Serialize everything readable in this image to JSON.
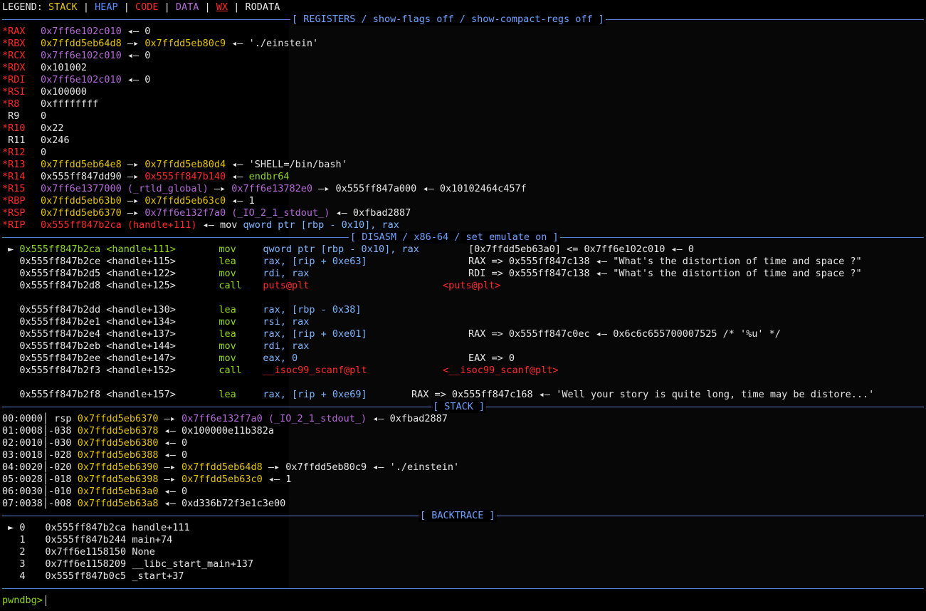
{
  "legend": {
    "label": "LEGEND:",
    "items": [
      {
        "text": "STACK",
        "color": "#e5c400"
      },
      {
        "text": "HEAP",
        "color": "#5a8dff"
      },
      {
        "text": "CODE",
        "color": "#ff2a2a"
      },
      {
        "text": "DATA",
        "color": "#b56bd8"
      },
      {
        "text": "WX",
        "color": "#ff2a2a"
      },
      {
        "text": "RODATA",
        "color": "#e6e6e6"
      }
    ]
  },
  "sections": {
    "registers": "[ REGISTERS / show-flags off / show-compact-regs off ]",
    "disasm": "[ DISASM / x86-64 / set emulate on ]",
    "stack": "[ STACK ]",
    "backtrace": "[ BACKTRACE ]"
  },
  "registers": [
    {
      "name": "*RAX",
      "val": "0x7ff6e102c010",
      "rest": " ◂— 0"
    },
    {
      "name": "*RBX",
      "val": "0x7ffdd5eb64d8",
      "mid": " —▸ ",
      "val2": "0x7ffdd5eb80c9",
      "rest": " ◂— './einstein'"
    },
    {
      "name": "*RCX",
      "val": "0x7ff6e102c010",
      "rest": " ◂— 0"
    },
    {
      "name": "*RDX",
      "val": "0x101002",
      "rest": ""
    },
    {
      "name": "*RDI",
      "val": "0x7ff6e102c010",
      "rest": " ◂— 0"
    },
    {
      "name": "*RSI",
      "val": "0x100000",
      "rest": ""
    },
    {
      "name": "*R8",
      "val": "0xffffffff",
      "rest": ""
    },
    {
      "name": " R9",
      "val": "0",
      "rest": ""
    },
    {
      "name": "*R10",
      "val": "0x22",
      "rest": ""
    },
    {
      "name": " R11",
      "val": "0x246",
      "rest": ""
    },
    {
      "name": "*R12",
      "val": "0",
      "rest": ""
    },
    {
      "name": "*R13",
      "val": "0x7ffdd5eb64e8",
      "mid": " —▸ ",
      "val2": "0x7ffdd5eb80d4",
      "rest": " ◂— 'SHELL=/bin/bash'"
    },
    {
      "name": "*R14",
      "val": "0x555ff847dd90",
      "mid": " —▸ ",
      "val2": "0x555ff847b140",
      "rest": " ◂— ",
      "tail": "endbr64"
    },
    {
      "name": "*R15",
      "val": "0x7ff6e1377000 (_rtld_global)",
      "mid": " —▸ ",
      "val2": "0x7ff6e13782e0",
      "rest": " —▸ 0x555ff847a000 ◂— 0x10102464c457f"
    },
    {
      "name": "*RBP",
      "val": "0x7ffdd5eb63b0",
      "mid": " —▸ ",
      "val2": "0x7ffdd5eb63c0",
      "rest": " ◂— 1"
    },
    {
      "name": "*RSP",
      "val": "0x7ffdd5eb6370",
      "mid": " —▸ ",
      "val2": "0x7ff6e132f7a0 (_IO_2_1_stdout_)",
      "rest": " ◂— 0xfbad2887"
    },
    {
      "name": "*RIP",
      "val": "0x555ff847b2ca (handle+111)",
      "rest": " ◂— mov ",
      "tail": "qword ptr [rbp - 0x10], rax"
    }
  ],
  "disasm": [
    {
      "marker": " ► ",
      "addr": "0x555ff847b2ca <handle+111>",
      "op": "mov",
      "args": "qword ptr [rbp - 0x10], rax",
      "comment": "[0x7ffdd5eb63a0] <= 0x7ff6e102c010 ◂— 0"
    },
    {
      "marker": "   ",
      "addr": "0x555ff847b2ce <handle+115>",
      "op": "lea",
      "args": "rax, [rip + 0xe63]",
      "comment": "RAX => 0x555ff847c138 ◂— \"What's the distortion of time and space ?\""
    },
    {
      "marker": "   ",
      "addr": "0x555ff847b2d5 <handle+122>",
      "op": "mov",
      "args": "rdi, rax",
      "comment": "RDI => 0x555ff847c138 ◂— \"What's the distortion of time and space ?\""
    },
    {
      "marker": "   ",
      "addr": "0x555ff847b2d8 <handle+125>",
      "op": "call",
      "args": "puts@plt",
      "comment": "<puts@plt>"
    },
    {
      "marker": "   ",
      "addr": "0x555ff847b2dd <handle+130>",
      "op": "lea",
      "args": "rax, [rbp - 0x38]",
      "comment": ""
    },
    {
      "marker": "   ",
      "addr": "0x555ff847b2e1 <handle+134>",
      "op": "mov",
      "args": "rsi, rax",
      "comment": ""
    },
    {
      "marker": "   ",
      "addr": "0x555ff847b2e4 <handle+137>",
      "op": "lea",
      "args": "rax, [rip + 0xe01]",
      "comment": "RAX => 0x555ff847c0ec ◂— 0x6c6c655700007525 /* '%u' */"
    },
    {
      "marker": "   ",
      "addr": "0x555ff847b2eb <handle+144>",
      "op": "mov",
      "args": "rdi, rax",
      "comment": ""
    },
    {
      "marker": "   ",
      "addr": "0x555ff847b2ee <handle+147>",
      "op": "mov",
      "args": "eax, 0",
      "comment": "EAX => 0"
    },
    {
      "marker": "   ",
      "addr": "0x555ff847b2f3 <handle+152>",
      "op": "call",
      "args": "__isoc99_scanf@plt",
      "comment": "<__isoc99_scanf@plt>"
    },
    {
      "marker": "   ",
      "addr": "0x555ff847b2f8 <handle+157>",
      "op": "lea",
      "args": "rax, [rip + 0xe69]",
      "comment": "RAX => 0x555ff847c168 ◂— 'Well your story is quite long, time may be distore...'"
    }
  ],
  "stack": [
    {
      "idx": "00:0000",
      "off": " rsp ",
      "addr": "0x7ffdd5eb6370",
      "mid": " —▸ ",
      "val": "0x7ff6e132f7a0 (_IO_2_1_stdout_)",
      "rest": " ◂— 0xfbad2887"
    },
    {
      "idx": "01:0008",
      "off": "-038 ",
      "addr": "0x7ffdd5eb6378",
      "mid": "",
      "val": "",
      "rest": " ◂— 0x100000e11b382a"
    },
    {
      "idx": "02:0010",
      "off": "-030 ",
      "addr": "0x7ffdd5eb6380",
      "mid": "",
      "val": "",
      "rest": " ◂— 0"
    },
    {
      "idx": "03:0018",
      "off": "-028 ",
      "addr": "0x7ffdd5eb6388",
      "mid": "",
      "val": "",
      "rest": " ◂— 0"
    },
    {
      "idx": "04:0020",
      "off": "-020 ",
      "addr": "0x7ffdd5eb6390",
      "mid": " —▸ ",
      "val": "0x7ffdd5eb64d8",
      "rest": " —▸ 0x7ffdd5eb80c9 ◂— './einstein'"
    },
    {
      "idx": "05:0028",
      "off": "-018 ",
      "addr": "0x7ffdd5eb6398",
      "mid": " —▸ ",
      "val": "0x7ffdd5eb63c0",
      "rest": " ◂— 1"
    },
    {
      "idx": "06:0030",
      "off": "-010 ",
      "addr": "0x7ffdd5eb63a0",
      "mid": "",
      "val": "",
      "rest": " ◂— 0"
    },
    {
      "idx": "07:0038",
      "off": "-008 ",
      "addr": "0x7ffdd5eb63a8",
      "mid": "",
      "val": "",
      "rest": " ◂— 0xd336b72f3e1c3e00"
    }
  ],
  "backtrace": [
    {
      "marker": " ► ",
      "num": "0",
      "addr": "0x555ff847b2ca",
      "sym": "handle+111"
    },
    {
      "marker": "   ",
      "num": "1",
      "addr": "0x555ff847b244",
      "sym": "main+74"
    },
    {
      "marker": "   ",
      "num": "2",
      "addr": "0x7ff6e1158150",
      "sym": "None"
    },
    {
      "marker": "   ",
      "num": "3",
      "addr": "0x7ff6e1158209",
      "sym": "__libc_start_main+137"
    },
    {
      "marker": "   ",
      "num": "4",
      "addr": "0x555ff847b0c5",
      "sym": "_start+37"
    }
  ],
  "prompt": "pwndbg>"
}
